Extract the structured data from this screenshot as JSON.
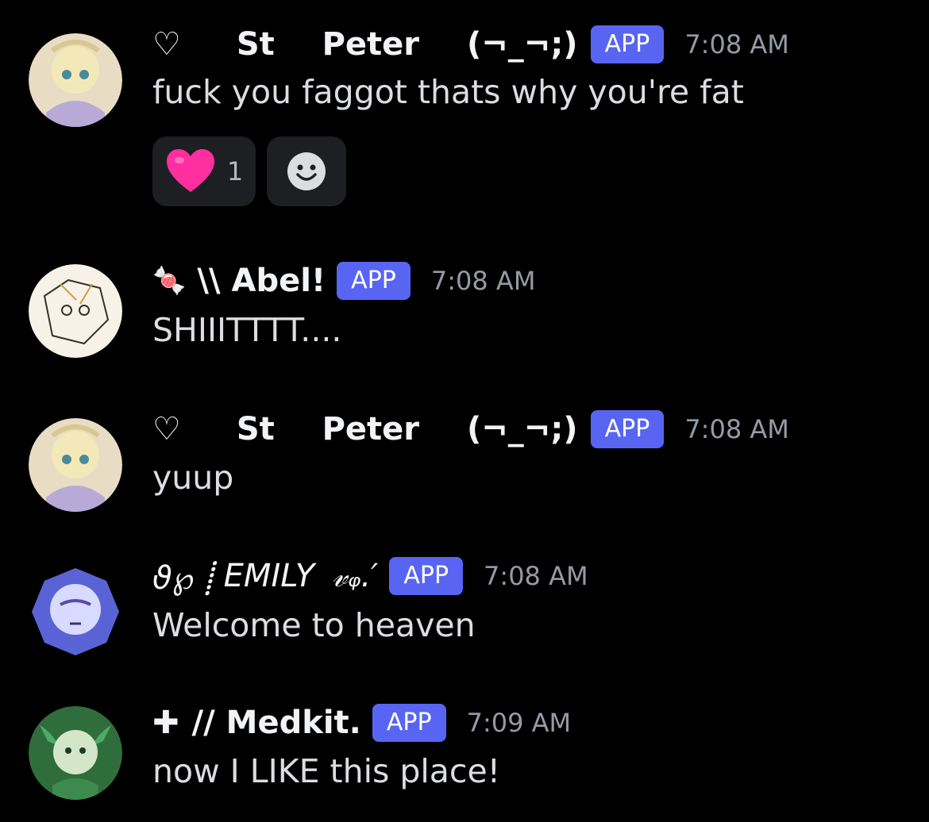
{
  "messages": [
    {
      "author_prefix": "♡",
      "author": "St   Peter",
      "author_suffix": "(¬_¬;)",
      "badge": "APP",
      "time": "7:08 AM",
      "text": "fuck you faggot thats why you're fat",
      "reactions": [
        {
          "emoji": "heart",
          "count": "1"
        },
        {
          "emoji": "add-reaction"
        }
      ]
    },
    {
      "author_prefix": "🍬",
      "author": "\\\\ Abel!",
      "badge": "APP",
      "time": "7:08 AM",
      "text": "SHIIITTTT...."
    },
    {
      "author_prefix": "♡",
      "author": "St   Peter",
      "author_suffix": "(¬_¬;)",
      "badge": "APP",
      "time": "7:08 AM",
      "text": "yuup"
    },
    {
      "author_prefix": "ϑ℘ ⸽",
      "author": "EMILY",
      "author_suffix": "𝓋ᵩ.′",
      "badge": "APP",
      "time": "7:08 AM",
      "text": "Welcome to heaven"
    },
    {
      "author_prefix": "✚",
      "author": "// Medkit.",
      "badge": "APP",
      "time": "7:09 AM",
      "text": "now I LIKE this place!"
    }
  ],
  "colors": {
    "background": "#000000",
    "badge": "#5865f2",
    "timestamp": "#949ba4",
    "reaction_bg": "#1e1f22"
  }
}
